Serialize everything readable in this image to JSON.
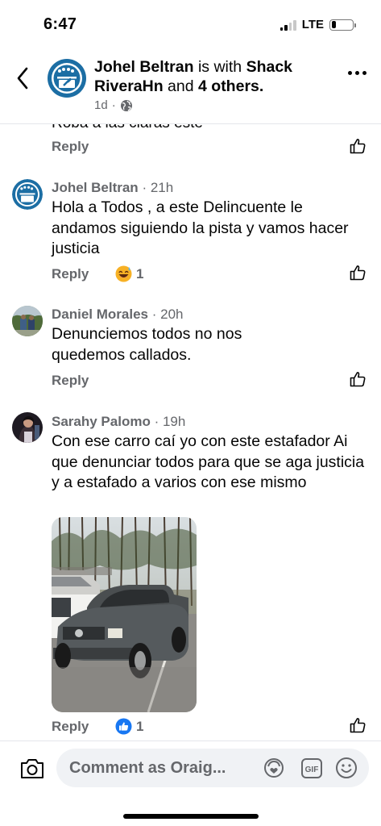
{
  "status": {
    "time": "6:47",
    "network": "LTE",
    "signal_bars": 4,
    "signal_bars_active": 2,
    "battery_level": 0.22
  },
  "header": {
    "author": "Johel Beltran",
    "with_word": "is with",
    "tagged": "Shack RiveraHn",
    "and_word": "and",
    "others": "4 others",
    "time": "1d",
    "separator": "·",
    "privacy_icon": "globe-icon",
    "avatar_color": "#1c6ea4"
  },
  "previous_comment": {
    "partial_text": "Roba a las claras este",
    "reply_label": "Reply"
  },
  "comments": [
    {
      "name": "Johel Beltran",
      "time": "21h",
      "text": "Hola a Todos , a este Delincuente le andamos siguiendo la pista y vamos hacer justicia",
      "reply_label": "Reply",
      "reaction_icon": "grinning-sweat-emoji",
      "reaction_count": "1"
    },
    {
      "name": "Daniel Morales",
      "time": "20h",
      "text": "Denunciemos todos no nos quedemos callados.",
      "reply_label": "Reply"
    },
    {
      "name": "Sarahy Palomo",
      "time": "19h",
      "text": "Con ese carro caí yo con este estafador Ai que denunciar todos para que se aga justicia y a estafado a varios con ese mismo",
      "reply_label": "Reply",
      "reaction_icon": "thumbs-up-reaction",
      "reaction_count": "1"
    }
  ],
  "composer": {
    "placeholder": "Comment as Oraig..."
  },
  "colors": {
    "brand_blue": "#1877f2",
    "meta_gray": "#65676b",
    "input_bg": "#f0f2f5"
  }
}
